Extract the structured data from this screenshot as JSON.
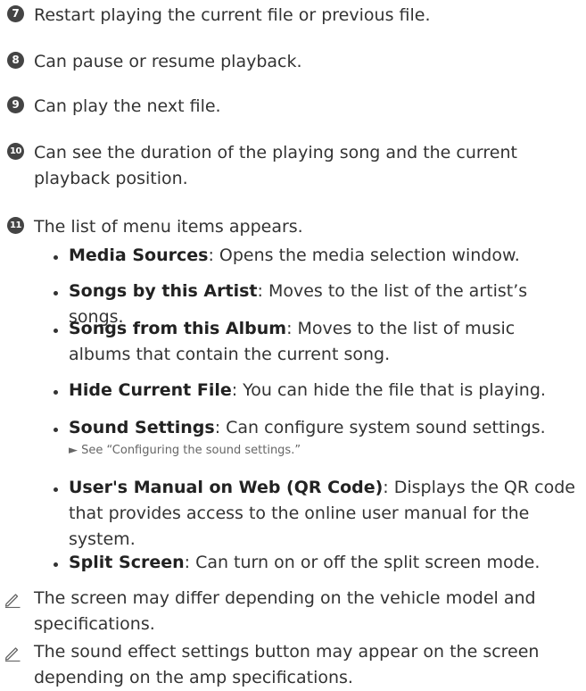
{
  "numbered_items": [
    {
      "badge": "7",
      "text": "Restart playing the current file or previous file."
    },
    {
      "badge": "8",
      "text": "Can pause or resume playback."
    },
    {
      "badge": "9",
      "text": "Can play the next file."
    },
    {
      "badge": "10",
      "text": "Can see the duration of the playing song and the current playback position."
    },
    {
      "badge": "11",
      "text": "The list of menu items appears."
    }
  ],
  "menu_items": [
    {
      "term": "Media Sources",
      "desc": ": Opens the media selection window."
    },
    {
      "term": "Songs by this Artist",
      "desc": ": Moves to the list of the artist’s songs."
    },
    {
      "term": "Songs from this Album",
      "desc": ": Moves to the list of music albums that contain the current song."
    },
    {
      "term": "Hide Current File",
      "desc": ": You can hide the file that is playing."
    },
    {
      "term": "Sound Settings",
      "desc": ": Can configure system sound settings.",
      "ref": "► See “Configuring the sound settings.”"
    },
    {
      "term": "User's Manual on Web (QR Code)",
      "desc": ": Displays the QR code that provides access to the online user manual for the system."
    },
    {
      "term": "Split Screen",
      "desc": ": Can turn on or off the split screen mode."
    }
  ],
  "notes": [
    {
      "icon": "pencil-icon",
      "text": "The screen may differ depending on the vehicle model and specifications."
    },
    {
      "icon": "pencil-icon",
      "text": "The sound effect settings button may appear on the screen depending on the amp specifications."
    }
  ]
}
